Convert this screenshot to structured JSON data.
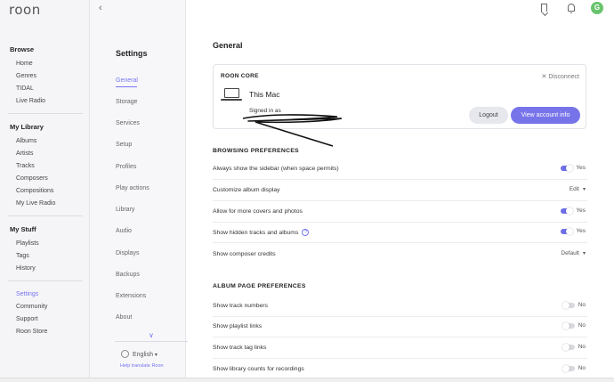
{
  "app": {
    "logo": "roon",
    "avatar_initial": "G"
  },
  "nav": {
    "browse_title": "Browse",
    "browse": [
      "Home",
      "Genres",
      "TIDAL",
      "Live Radio"
    ],
    "library_title": "My Library",
    "library": [
      "Albums",
      "Artists",
      "Tracks",
      "Composers",
      "Compositions",
      "My Live Radio"
    ],
    "stuff_title": "My Stuff",
    "stuff": [
      "Playlists",
      "Tags",
      "History"
    ],
    "bottom": [
      "Settings",
      "Community",
      "Support",
      "Roon Store"
    ]
  },
  "settings": {
    "title": "Settings",
    "items": [
      "General",
      "Storage",
      "Services",
      "Setup",
      "Profiles",
      "Play actions",
      "Library",
      "Audio",
      "Displays",
      "Backups",
      "Extensions",
      "About"
    ],
    "language": "English",
    "help_translate": "Help translate Roon"
  },
  "general": {
    "title": "General",
    "core": {
      "label": "ROON CORE",
      "disconnect": "Disconnect",
      "name": "This Mac",
      "signed_in": "Signed in as",
      "logout": "Logout",
      "view_account": "View account info"
    },
    "browsing_title": "BROWSING PREFERENCES",
    "browsing": [
      {
        "label": "Always show the sidebar (when space permits)",
        "value": "Yes",
        "toggle": true
      },
      {
        "label": "Customize album display",
        "value": "Edit",
        "toggle": null
      },
      {
        "label": "Allow for more covers and photos",
        "value": "Yes",
        "toggle": true
      },
      {
        "label": "Show hidden tracks and albums",
        "value": "Yes",
        "toggle": true
      },
      {
        "label": "Show composer credits",
        "value": "Default",
        "toggle": null
      }
    ],
    "album_title": "ALBUM PAGE PREFERENCES",
    "album": [
      {
        "label": "Show track numbers",
        "value": "No",
        "toggle": false
      },
      {
        "label": "Show playlist links",
        "value": "No",
        "toggle": false
      },
      {
        "label": "Show track tag links",
        "value": "No",
        "toggle": false
      },
      {
        "label": "Show library counts for recordings",
        "value": "No",
        "toggle": false
      }
    ]
  },
  "colors": {
    "accent": "#7574f3",
    "toggle_on": "#6f6ee8",
    "avatar": "#69c46d"
  }
}
